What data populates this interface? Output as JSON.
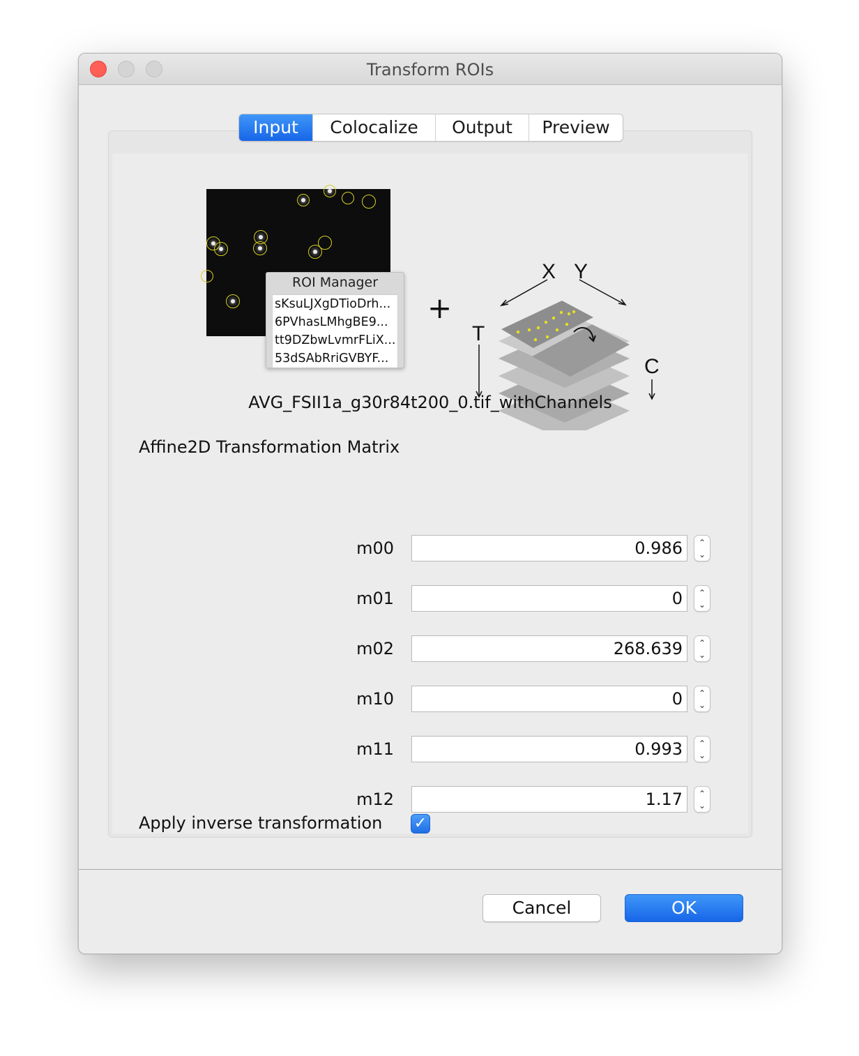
{
  "window": {
    "title": "Transform ROIs"
  },
  "tabs": [
    {
      "label": "Input",
      "active": true
    },
    {
      "label": "Colocalize",
      "active": false
    },
    {
      "label": "Output",
      "active": false
    },
    {
      "label": "Preview",
      "active": false
    }
  ],
  "illustration": {
    "roi_manager_title": "ROI Manager",
    "roi_items": [
      "sKsuLJXgDTioDrh...",
      "6PVhasLMhgBE9...",
      "tt9DZbwLvmrFLiX...",
      "53dSAbRriGVBYF..."
    ],
    "plus_sign": "+",
    "axis_x": "X",
    "axis_y": "Y",
    "axis_t": "T",
    "axis_c": "C"
  },
  "image_name": "AVG_FSII1a_g30r84t200_0.tif_withChannels",
  "matrix": {
    "title": "Affine2D Transformation Matrix",
    "rows": [
      {
        "label": "m00",
        "value": "0.986"
      },
      {
        "label": "m01",
        "value": "0"
      },
      {
        "label": "m02",
        "value": "268.639"
      },
      {
        "label": "m10",
        "value": "0"
      },
      {
        "label": "m11",
        "value": "0.993"
      },
      {
        "label": "m12",
        "value": "1.17"
      }
    ]
  },
  "inverse": {
    "label": "Apply inverse transformation",
    "checked": true
  },
  "buttons": {
    "cancel": "Cancel",
    "ok": "OK"
  },
  "colors": {
    "accent": "#1e6fe6",
    "roi_circle": "#d6d020",
    "close": "#fe5f57"
  }
}
